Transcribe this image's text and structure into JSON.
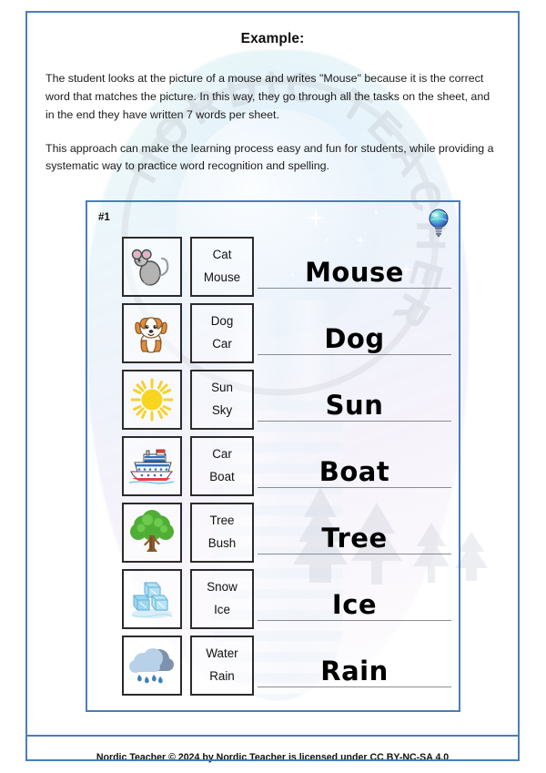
{
  "page": {
    "title": "Example:",
    "border_color": "#4a7ebb",
    "background_color": "#ffffff"
  },
  "intro": {
    "paragraph_1": "The student looks at the picture of a mouse and writes \"Mouse\" because it is the correct word that matches the picture. In this way, they go through all the tasks on the sheet, and in the end they have written 7 words per sheet.",
    "paragraph_2": "This approach can make the learning process easy and fun for students, while providing a systematic way to practice word recognition and spelling."
  },
  "watermark": {
    "ring_text": "NORDIC TEACHER"
  },
  "worksheet": {
    "number_label": "#1",
    "logo_icon": "lightbulb-icon",
    "border_color": "#4a7ebb",
    "rows": [
      {
        "picture_icon": "mouse-icon",
        "option_top": "Cat",
        "option_bottom": "Mouse",
        "answer": "Mouse"
      },
      {
        "picture_icon": "dog-icon",
        "option_top": "Dog",
        "option_bottom": "Car",
        "answer": "Dog"
      },
      {
        "picture_icon": "sun-icon",
        "option_top": "Sun",
        "option_bottom": "Sky",
        "answer": "Sun"
      },
      {
        "picture_icon": "boat-icon",
        "option_top": "Car",
        "option_bottom": "Boat",
        "answer": "Boat"
      },
      {
        "picture_icon": "tree-icon",
        "option_top": "Tree",
        "option_bottom": "Bush",
        "answer": "Tree"
      },
      {
        "picture_icon": "ice-icon",
        "option_top": "Snow",
        "option_bottom": "Ice",
        "answer": "Ice"
      },
      {
        "picture_icon": "rain-cloud-icon",
        "option_top": "Water",
        "option_bottom": "Rain",
        "answer": "Rain"
      }
    ]
  },
  "footer": {
    "credit": "Nordic Teacher © 2024 by Nordic Teacher is licensed under CC BY-NC-SA 4.0"
  }
}
